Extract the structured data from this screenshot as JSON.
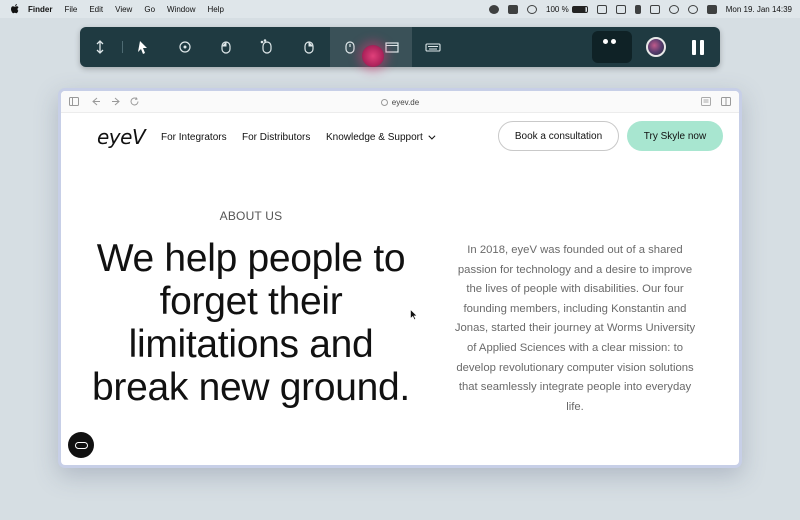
{
  "menubar": {
    "app": "Finder",
    "items": [
      "File",
      "Edit",
      "View",
      "Go",
      "Window",
      "Help"
    ],
    "battery": "100 %",
    "datetime": "Mon 19. Jan  14:39"
  },
  "toolbar": {
    "icons": [
      "move-vertical-icon",
      "pointer-icon",
      "crosshair-icon",
      "left-click-icon",
      "double-click-icon",
      "right-click-icon",
      "mouse-scroll-icon",
      "window-icon",
      "keyboard-icon",
      "face-tracking-icon",
      "avatar-icon",
      "pause-icon"
    ]
  },
  "browser": {
    "url": "eyev.de"
  },
  "site": {
    "logo": "eyeV",
    "nav": {
      "integrators": "For Integrators",
      "distributors": "For Distributors",
      "knowledge": "Knowledge & Support"
    },
    "cta_consult": "Book a consultation",
    "cta_try": "Try Skyle now",
    "eyebrow": "ABOUT US",
    "headline": "We help people to forget their limitations and break new ground.",
    "body": "In 2018, eyeV was founded out of a shared passion for technology and a desire to improve the lives of people with disabilities. Our four founding members, including Konstantin and Jonas, started their journey at Worms University of Applied Sciences with a clear mission: to develop revolutionary computer vision solutions that seamlessly integrate people into everyday life.",
    "colors": {
      "mint": "#a8e6d0",
      "toolbar": "#1f3a41",
      "record": "#c0306a"
    }
  }
}
